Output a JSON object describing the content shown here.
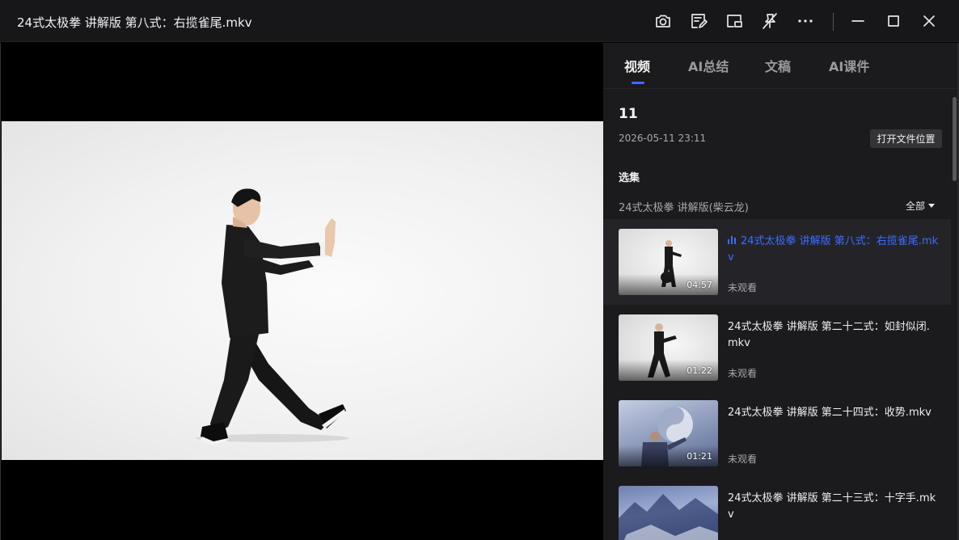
{
  "window": {
    "title": "24式太极拳 讲解版 第八式：右揽雀尾.mkv",
    "icons": [
      "camera-icon",
      "edit-note-icon",
      "picture-in-picture-icon",
      "pin-off-icon",
      "more-icon",
      "minimize-icon",
      "maximize-icon",
      "close-icon"
    ]
  },
  "panel": {
    "tabs": [
      "视频",
      "AI总结",
      "文稿",
      "AI课件"
    ],
    "active_tab": "视频",
    "folder": {
      "name": "11",
      "date": "2026-05-11 23:11",
      "open_button": "打开文件位置"
    },
    "section_label": "选集",
    "series_name": "24式太极拳 讲解版(柴云龙)",
    "filter_label": "全部",
    "items": [
      {
        "title": "24式太极拳 讲解版 第八式：右揽雀尾.mkv",
        "duration": "04:57",
        "status": "未观看",
        "active": true
      },
      {
        "title": "24式太极拳 讲解版 第二十二式：如封似闭.mkv",
        "duration": "01:22",
        "status": "未观看",
        "active": false
      },
      {
        "title": "24式太极拳 讲解版 第二十四式：收势.mkv",
        "duration": "01:21",
        "status": "未观看",
        "active": false
      },
      {
        "title": "24式太极拳 讲解版 第二十三式：十字手.mkv",
        "duration": "",
        "status": "",
        "active": false
      }
    ]
  },
  "colors": {
    "accent": "#3b6cff",
    "panel_bg": "#1b1b1e",
    "titlebar_bg": "#17171a"
  }
}
